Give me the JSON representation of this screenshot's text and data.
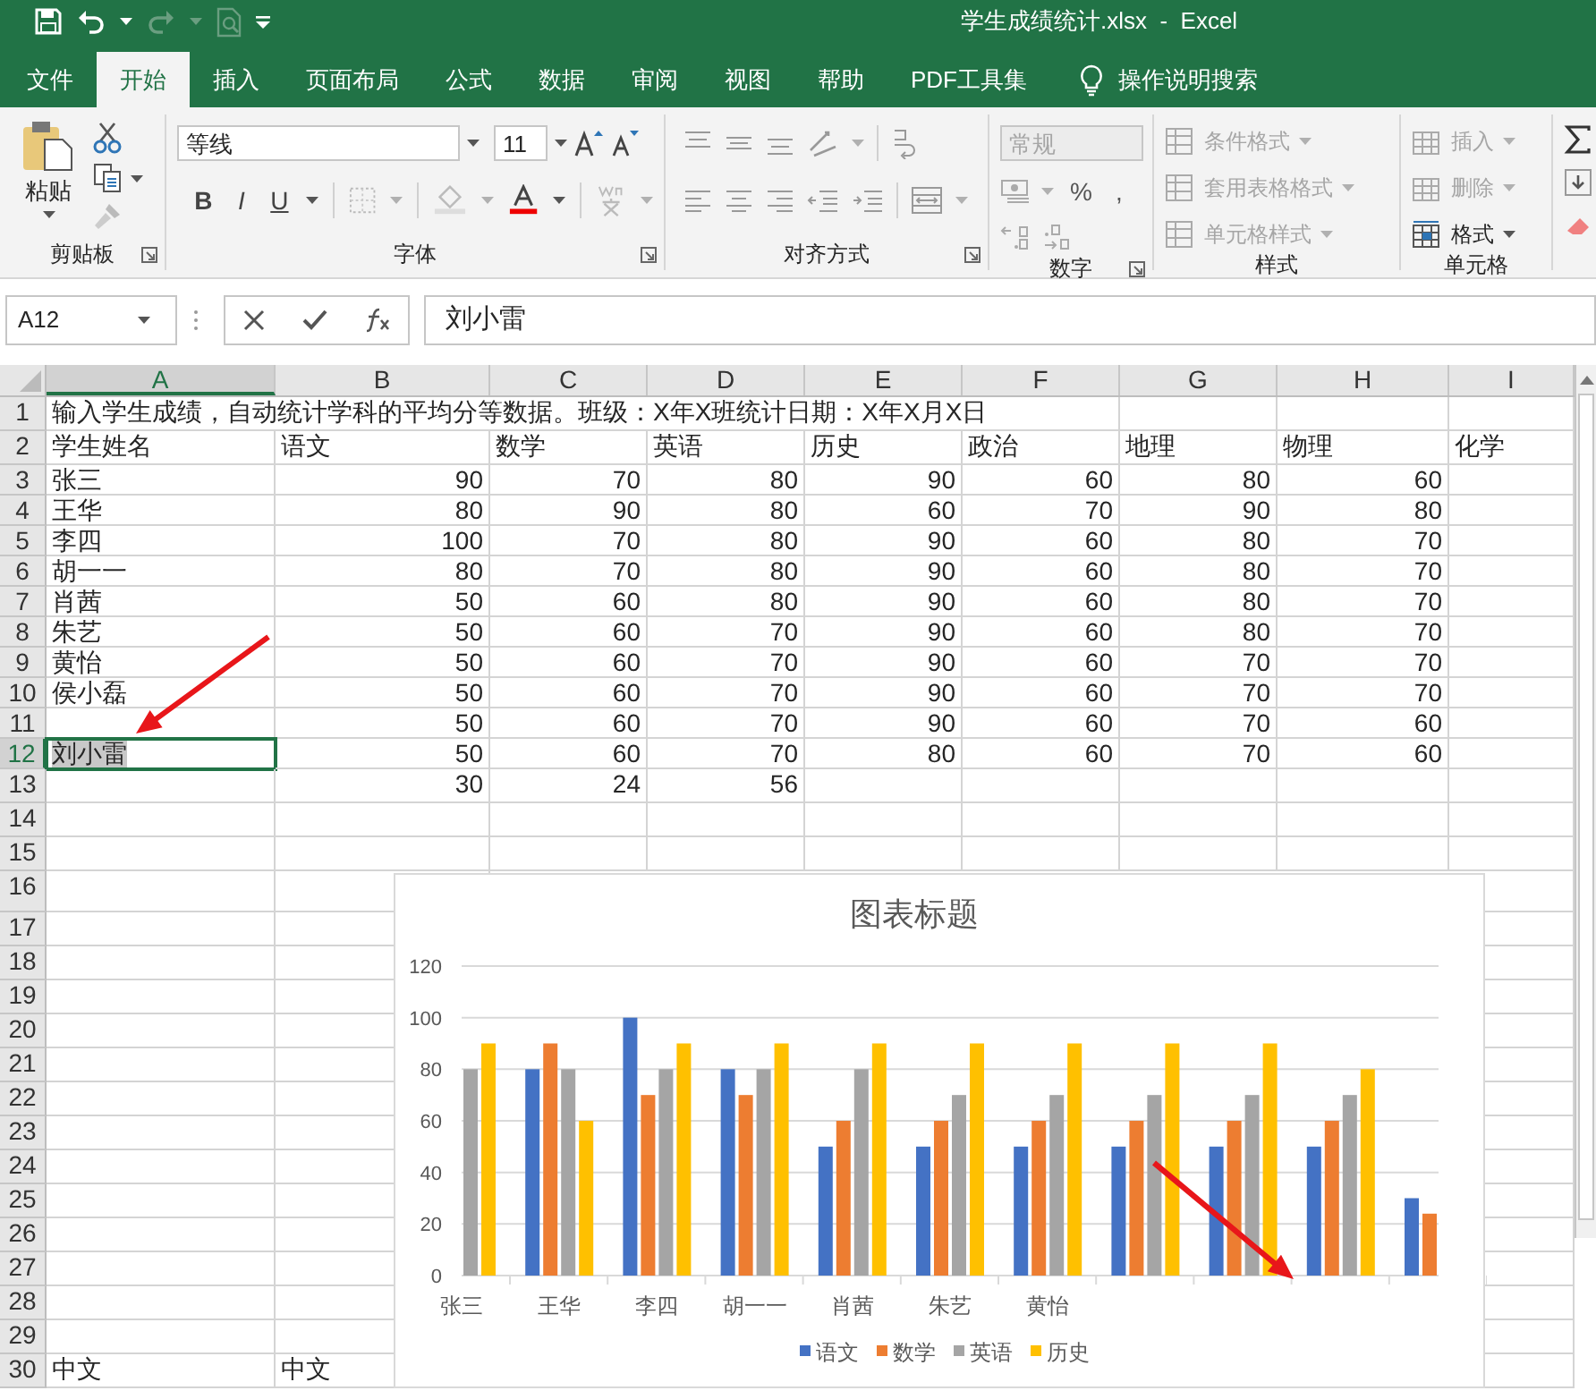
{
  "title_bar": {
    "title": "学生成绩统计.xlsx  -  Excel"
  },
  "tabs": [
    {
      "label": "文件",
      "selected": false
    },
    {
      "label": "开始",
      "selected": true
    },
    {
      "label": "插入",
      "selected": false
    },
    {
      "label": "页面布局",
      "selected": false
    },
    {
      "label": "公式",
      "selected": false
    },
    {
      "label": "数据",
      "selected": false
    },
    {
      "label": "审阅",
      "selected": false
    },
    {
      "label": "视图",
      "selected": false
    },
    {
      "label": "帮助",
      "selected": false
    },
    {
      "label": "PDF工具集",
      "selected": false
    }
  ],
  "tell_me": {
    "placeholder": "操作说明搜索"
  },
  "ribbon": {
    "clipboard": {
      "paste": "粘贴",
      "label": "剪贴板"
    },
    "font": {
      "name": "等线",
      "size": "11",
      "bold": "B",
      "italic": "I",
      "underline": "U",
      "label": "字体"
    },
    "alignment": {
      "label": "对齐方式"
    },
    "number": {
      "format": "常规",
      "format_disabled": true,
      "percent": "%",
      "comma": ",",
      "label": "数字"
    },
    "styles": {
      "label": "样式",
      "items": [
        {
          "label": "条件格式",
          "disabled": true
        },
        {
          "label": "套用表格格式",
          "disabled": true
        },
        {
          "label": "单元格样式",
          "disabled": true
        }
      ]
    },
    "cells": {
      "label": "单元格",
      "items": [
        {
          "label": "插入",
          "disabled": true
        },
        {
          "label": "删除",
          "disabled": true
        },
        {
          "label": "格式",
          "disabled": false
        }
      ]
    }
  },
  "formula_bar": {
    "name_box": "A12",
    "value": "刘小雷"
  },
  "sheet": {
    "columns": [
      {
        "label": "A",
        "selected": true
      },
      {
        "label": "B",
        "selected": false
      },
      {
        "label": "C",
        "selected": false
      },
      {
        "label": "D",
        "selected": false
      },
      {
        "label": "E",
        "selected": false
      },
      {
        "label": "F",
        "selected": false
      },
      {
        "label": "G",
        "selected": false
      },
      {
        "label": "H",
        "selected": false
      },
      {
        "label": "I",
        "selected": false
      }
    ],
    "rows": [
      {
        "number": "1",
        "selected": false,
        "kind": "text",
        "cells": [
          "输入学生成绩，自动统计学科的平均分等数据。班级：X年X班统计日期：X年X月X日"
        ]
      },
      {
        "number": "2",
        "selected": false,
        "kind": "text",
        "cells": [
          "学生姓名",
          "语文",
          "数学",
          "英语",
          "历史",
          "政治",
          "地理",
          "物理",
          "化学"
        ]
      },
      {
        "number": "3",
        "selected": false,
        "kind": "scores",
        "cells": [
          "张三",
          "90",
          "70",
          "80",
          "90",
          "60",
          "80",
          "60"
        ]
      },
      {
        "number": "4",
        "selected": false,
        "kind": "scores",
        "cells": [
          "王华",
          "80",
          "90",
          "80",
          "60",
          "70",
          "90",
          "80"
        ]
      },
      {
        "number": "5",
        "selected": false,
        "kind": "scores",
        "cells": [
          "李四",
          "100",
          "70",
          "80",
          "90",
          "60",
          "80",
          "70"
        ]
      },
      {
        "number": "6",
        "selected": false,
        "kind": "scores",
        "cells": [
          "胡一一",
          "80",
          "70",
          "80",
          "90",
          "60",
          "80",
          "70"
        ]
      },
      {
        "number": "7",
        "selected": false,
        "kind": "scores",
        "cells": [
          "肖茜",
          "50",
          "60",
          "80",
          "90",
          "60",
          "80",
          "70"
        ]
      },
      {
        "number": "8",
        "selected": false,
        "kind": "scores",
        "cells": [
          "朱艺",
          "50",
          "60",
          "70",
          "90",
          "60",
          "80",
          "70"
        ]
      },
      {
        "number": "9",
        "selected": false,
        "kind": "scores",
        "cells": [
          "黄怡",
          "50",
          "60",
          "70",
          "90",
          "60",
          "70",
          "70"
        ]
      },
      {
        "number": "10",
        "selected": false,
        "kind": "scores",
        "cells": [
          "侯小磊",
          "50",
          "60",
          "70",
          "90",
          "60",
          "70",
          "70"
        ]
      },
      {
        "number": "11",
        "selected": false,
        "kind": "scores",
        "cells": [
          null,
          "50",
          "60",
          "70",
          "90",
          "60",
          "70",
          "60"
        ]
      },
      {
        "number": "12",
        "selected": true,
        "kind": "scores",
        "cells": [
          "刘小雷",
          "50",
          "60",
          "70",
          "80",
          "60",
          "70",
          "60"
        ]
      },
      {
        "number": "13",
        "selected": false,
        "kind": "scores",
        "cells": [
          null,
          "30",
          "24",
          "56"
        ]
      },
      {
        "number": "14",
        "selected": false
      },
      {
        "number": "15",
        "selected": false
      },
      {
        "number": "16",
        "selected": false
      },
      {
        "number": "17",
        "selected": false
      },
      {
        "number": "18",
        "selected": false
      },
      {
        "number": "19",
        "selected": false
      },
      {
        "number": "20",
        "selected": false
      },
      {
        "number": "21",
        "selected": false
      },
      {
        "number": "22",
        "selected": false
      },
      {
        "number": "23",
        "selected": false
      },
      {
        "number": "24",
        "selected": false
      },
      {
        "number": "25",
        "selected": false
      },
      {
        "number": "26",
        "selected": false
      },
      {
        "number": "27",
        "selected": false
      },
      {
        "number": "28",
        "selected": false
      },
      {
        "number": "29",
        "selected": false
      },
      {
        "number": "30",
        "selected": false,
        "kind": "text",
        "cells": [
          "中文",
          "中文"
        ]
      }
    ],
    "chart": {
      "chart_data": {
        "type": "bar",
        "grid": true,
        "legend": "bottom",
        "title": "图表标题",
        "categories": [
          "张三",
          "王华",
          "李四",
          "胡一一",
          "肖茜",
          "朱艺",
          "黄怡",
          null,
          null,
          null,
          null
        ],
        "ylim": [
          0,
          120
        ],
        "yticks": [
          0,
          20,
          40,
          60,
          80,
          100,
          120
        ],
        "series": [
          {
            "name": "语文",
            "color": "#4472c4",
            "values": [
              null,
              80,
              100,
              80,
              50,
              50,
              50,
              50,
              50,
              50,
              30
            ]
          },
          {
            "name": "数学",
            "color": "#ed7d31",
            "values": [
              null,
              90,
              70,
              70,
              60,
              60,
              60,
              60,
              60,
              60,
              24
            ]
          },
          {
            "name": "英语",
            "color": "#a5a5a5",
            "values": [
              80,
              80,
              80,
              80,
              80,
              70,
              70,
              70,
              70,
              70,
              null
            ]
          },
          {
            "name": "历史",
            "color": "#ffc000",
            "values": [
              90,
              60,
              90,
              90,
              90,
              90,
              90,
              90,
              90,
              80,
              null
            ]
          }
        ]
      }
    }
  }
}
